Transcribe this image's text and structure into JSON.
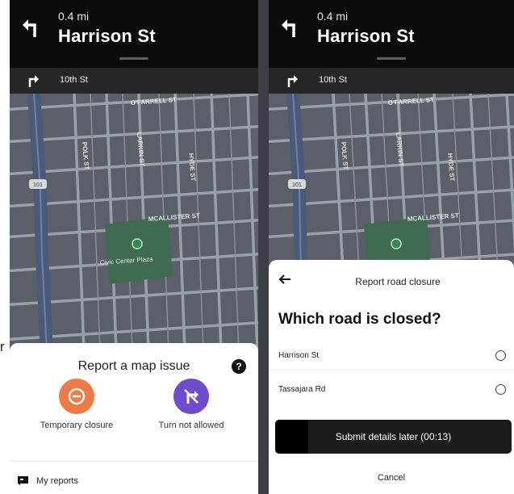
{
  "left_screen": {
    "distance": "0.4 mi",
    "street": "Harrison St",
    "next_street": "10th St",
    "map_labels": {
      "ofarrell": "O'FARRELL ST",
      "polk": "POLK ST",
      "larkin": "LARKIN ST",
      "hyde": "HYDE ST",
      "mcallister": "MCALLISTER ST",
      "plaza": "Civic Center Plaza",
      "shield": "101"
    },
    "panel": {
      "title": "Report a map issue",
      "help": "?",
      "actions": [
        {
          "label": "Temporary closure",
          "icon": "minus-icon",
          "color": "#f07a45"
        },
        {
          "label": "Turn not allowed",
          "icon": "no-turn-icon",
          "color": "#6f4bd0"
        }
      ],
      "my_reports": "My reports"
    }
  },
  "right_screen": {
    "distance": "0.4 mi",
    "street": "Harrison St",
    "next_street": "10th St",
    "map_labels": {
      "ofarrell": "O'FARRELL ST",
      "polk": "POLK ST",
      "larkin": "LARKIN ST",
      "hyde": "HYDE ST",
      "mcallister": "MCALLISTER ST",
      "shield": "101"
    },
    "sheet": {
      "title": "Report road closure",
      "question": "Which road is closed?",
      "options": [
        "Harrison St",
        "Tassajara Rd"
      ],
      "submit": "Submit details later (00:13)",
      "submit_progress": 0.14,
      "cancel": "Cancel"
    }
  },
  "edge_text": "r",
  "colors": {
    "header": "#0b0b0b",
    "subheader": "#262626",
    "map_block": "#5a5f68",
    "street": "#9aa0a8",
    "highway": "#4a5a7a",
    "park": "#3f6b50"
  }
}
